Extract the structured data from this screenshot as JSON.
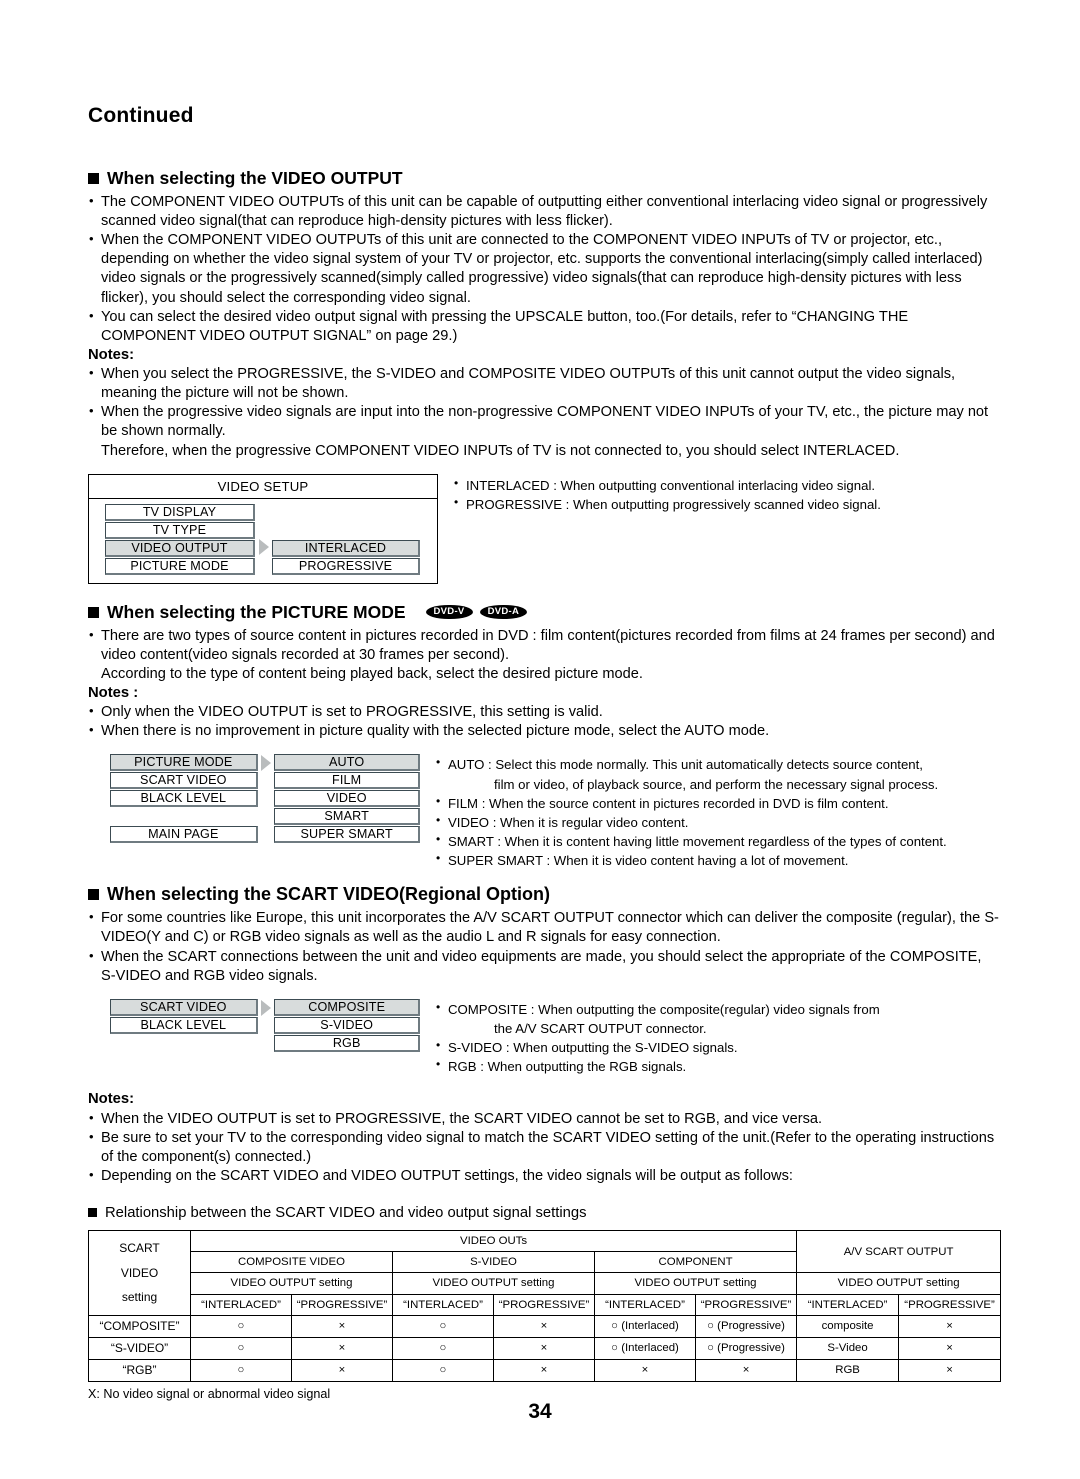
{
  "page": {
    "continued_label": "Continued",
    "page_number": "34"
  },
  "video_output": {
    "heading": "When selecting the VIDEO OUTPUT",
    "bullets": [
      "The COMPONENT VIDEO OUTPUTs of this unit can be capable of outputting either conventional interlacing video signal or progressively scanned video signal(that can reproduce high-density pictures with less flicker).",
      "When the COMPONENT VIDEO OUTPUTs of this unit are connected to the COMPONENT VIDEO INPUTs of TV or projector, etc., depending on whether the video signal system of your TV or projector, etc. supports the conventional interlacing(simply called interlaced) video signals or the progressively scanned(simply called progressive) video signals(that can reproduce high-density pictures with less flicker), you should select the corresponding video signal.",
      "You can select the desired video output signal with pressing the UPSCALE button, too.(For details, refer to “CHANGING THE COMPONENT VIDEO OUTPUT SIGNAL” on page 29.)"
    ],
    "notes_label": "Notes:",
    "notes": [
      "When you select the PROGRESSIVE, the S-VIDEO and COMPOSITE VIDEO OUTPUTs of this unit cannot output the video signals, meaning the picture will not be shown.",
      "When the progressive video signals are input into the non-progressive COMPONENT VIDEO INPUTs of your TV, etc., the picture may not be shown normally."
    ],
    "notes_continuation": "Therefore, when the progressive COMPONENT VIDEO INPUTs of TV is not connected to, you should select INTERLACED.",
    "menu": {
      "title": "VIDEO SETUP",
      "left_items": [
        {
          "label": "TV DISPLAY",
          "selected": false
        },
        {
          "label": "TV TYPE",
          "selected": false
        },
        {
          "label": "VIDEO OUTPUT",
          "selected": true
        },
        {
          "label": "PICTURE MODE",
          "selected": false
        }
      ],
      "right_items": [
        {
          "label": "INTERLACED",
          "selected": true
        },
        {
          "label": "PROGRESSIVE",
          "selected": false
        }
      ]
    },
    "legend": [
      "INTERLACED : When outputting conventional interlacing video signal.",
      "PROGRESSIVE : When outputting progressively scanned video signal."
    ]
  },
  "picture_mode": {
    "heading": "When selecting the PICTURE MODE",
    "badges": [
      "DVD-V",
      "DVD-A"
    ],
    "bullets": [
      "There are two types of source content in pictures recorded in DVD : film content(pictures recorded from films at 24 frames per second) and video content(video signals recorded at 30 frames per second)."
    ],
    "continuation": "According to the type of content being played back, select the desired picture mode.",
    "notes_label": "Notes :",
    "notes": [
      "Only when the VIDEO OUTPUT is set to PROGRESSIVE, this setting is valid.",
      "When there is no improvement in picture quality with the selected picture mode, select the AUTO mode."
    ],
    "menu": {
      "left_items": [
        {
          "label": "PICTURE MODE",
          "selected": true
        },
        {
          "label": "SCART VIDEO",
          "selected": false
        },
        {
          "label": "BLACK LEVEL",
          "selected": false
        },
        {
          "label": "",
          "selected": false,
          "blank": true
        },
        {
          "label": "MAIN PAGE",
          "selected": false
        }
      ],
      "right_items": [
        {
          "label": "AUTO",
          "selected": true
        },
        {
          "label": "FILM",
          "selected": false
        },
        {
          "label": "VIDEO",
          "selected": false
        },
        {
          "label": "SMART",
          "selected": false
        },
        {
          "label": "SUPER SMART",
          "selected": false
        }
      ]
    },
    "legend": [
      {
        "text": "AUTO : Select this mode normally. This unit automatically detects source content,",
        "bullet": true
      },
      {
        "text": "film or video, of playback source, and perform the necessary signal process.",
        "bullet": false
      },
      {
        "text": "FILM : When the source content in pictures recorded in DVD is film content.",
        "bullet": true
      },
      {
        "text": "VIDEO : When it is regular video content.",
        "bullet": true
      },
      {
        "text": "SMART : When it is content having little movement regardless of the types of content.",
        "bullet": true
      },
      {
        "text": "SUPER SMART : When it is video content having a lot of movement.",
        "bullet": true
      }
    ]
  },
  "scart_video": {
    "heading": "When selecting the SCART VIDEO(Regional Option)",
    "bullets": [
      "For some countries like Europe, this unit incorporates the A/V SCART OUTPUT connector which can deliver the composite (regular), the S-VIDEO(Y and C) or RGB video signals as well as the audio L and R signals for easy connection.",
      "When the SCART connections between the unit and video equipments are made, you should select the appropriate of the COMPOSITE, S-VIDEO and RGB video signals."
    ],
    "menu": {
      "left_items": [
        {
          "label": "SCART VIDEO",
          "selected": true
        },
        {
          "label": "BLACK LEVEL",
          "selected": false
        }
      ],
      "right_items": [
        {
          "label": "COMPOSITE",
          "selected": true
        },
        {
          "label": "S-VIDEO",
          "selected": false
        },
        {
          "label": "RGB",
          "selected": false
        }
      ]
    },
    "legend": [
      {
        "text": "COMPOSITE : When outputting the composite(regular) video signals from",
        "bullet": true
      },
      {
        "text": "the A/V SCART OUTPUT connector.",
        "bullet": false
      },
      {
        "text": "S-VIDEO : When outputting the S-VIDEO signals.",
        "bullet": true
      },
      {
        "text": "RGB : When outputting the RGB signals.",
        "bullet": true
      }
    ],
    "notes_label": "Notes:",
    "notes": [
      "When the VIDEO OUTPUT is set to PROGRESSIVE, the SCART VIDEO cannot be set to RGB, and vice versa.",
      "Be sure to set your TV to the corresponding video signal to match the SCART VIDEO setting of the unit.(Refer to the operating instructions of the component(s) connected.)",
      "Depending on the SCART VIDEO and VIDEO OUTPUT settings, the video signals will be output as follows:"
    ]
  },
  "relationship": {
    "heading": "Relationship between the SCART VIDEO and video output signal settings",
    "corner_lines": [
      "SCART",
      "VIDEO",
      "setting"
    ],
    "group_videoouts": "VIDEO OUTs",
    "group_avscart": "A/V SCART OUTPUT",
    "sub_groups": [
      "COMPOSITE VIDEO",
      "S-VIDEO",
      "COMPONENT"
    ],
    "setting_label": "VIDEO OUTPUT setting",
    "setting_label_scart": "VIDEO OUTPUT setting",
    "col_interlaced": "“INTERLACED”",
    "col_progressive": "“PROGRESSIVE”",
    "rows": [
      {
        "label": "“COMPOSITE”",
        "cells": [
          "○",
          "×",
          "○",
          "×",
          "○ (Interlaced)",
          "○ (Progressive)",
          "composite",
          "×"
        ]
      },
      {
        "label": "“S-VIDEO”",
        "cells": [
          "○",
          "×",
          "○",
          "×",
          "○ (Interlaced)",
          "○ (Progressive)",
          "S-Video",
          "×"
        ]
      },
      {
        "label": "“RGB”",
        "cells": [
          "○",
          "×",
          "○",
          "×",
          "×",
          "×",
          "RGB",
          "×"
        ]
      }
    ],
    "footnote": "X: No video signal or abnormal video signal"
  }
}
